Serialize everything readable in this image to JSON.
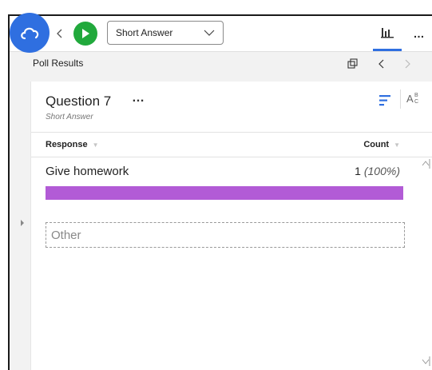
{
  "toolbar": {
    "question_type": "Short Answer",
    "more_label": "…"
  },
  "results_bar": {
    "title": "Poll Results"
  },
  "question": {
    "title": "Question 7",
    "more_label": "…",
    "type_label": "Short Answer"
  },
  "table": {
    "header_response": "Response",
    "header_count": "Count",
    "rows": [
      {
        "response": "Give homework",
        "count": "1",
        "percent": "(100%)",
        "share": 1.0
      }
    ]
  },
  "other_label": "Other",
  "colors": {
    "bar_fill": "#b25bd6",
    "accent_blue": "#2f6fe0",
    "play_green": "#21a93c"
  },
  "icons": {
    "app": "cloud-icon",
    "back": "chevron-left-icon",
    "play": "play-icon",
    "dropdown": "chevron-down-icon",
    "results": "bar-chart-icon",
    "copy": "copy-icon",
    "prev": "chevron-left-icon",
    "next": "chevron-right-icon",
    "sort": "sort-lines-icon",
    "alpha": "alphabetical-icon"
  }
}
